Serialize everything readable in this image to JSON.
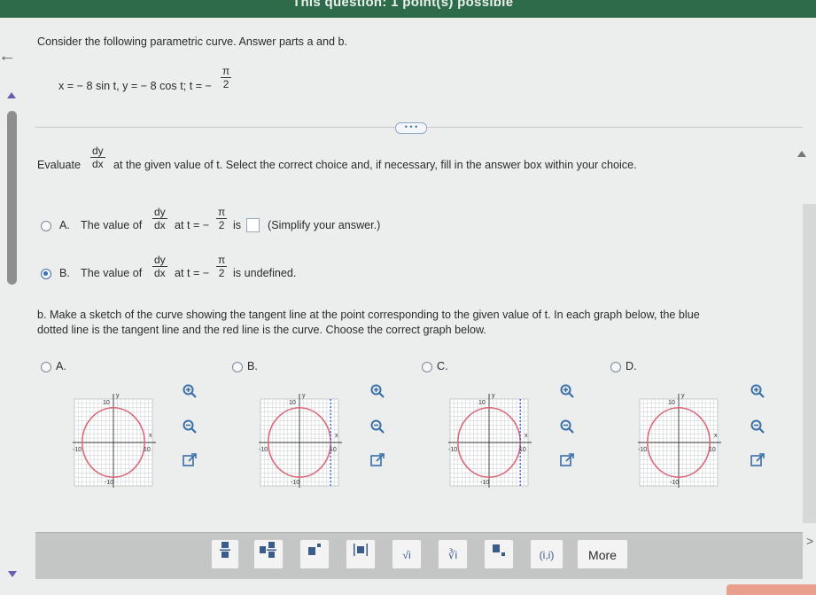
{
  "header": {
    "title": "This question: 1 point(s) possible"
  },
  "question": {
    "intro": "Consider the following parametric curve. Answer parts a and b.",
    "equation_prefix": "x = − 8 sin t, y = − 8 cos t; t = −",
    "t_num": "π",
    "t_den": "2",
    "more_indicator": "• • •"
  },
  "part_a": {
    "evaluate_word": "Evaluate",
    "dy": "dy",
    "dx": "dx",
    "evaluate_rest": "at the given value of t. Select the correct choice and, if necessary, fill in the answer box within your choice.",
    "choices": [
      {
        "letter": "A.",
        "lead": "The value of",
        "at_t": "at t = −",
        "tail": "is",
        "note": "(Simplify your answer.)",
        "selected": false
      },
      {
        "letter": "B.",
        "lead": "The value of",
        "at_t": "at t = −",
        "tail": "is undefined.",
        "selected": true
      }
    ]
  },
  "part_b": {
    "text_line1": "b. Make a sketch of the curve showing the tangent line at the point corresponding to the given value of t. In each graph below, the blue",
    "text_line2": "dotted line is the tangent line and the red line is the curve. Choose the correct graph below.",
    "graphs": [
      {
        "letter": "A.",
        "tangent": "none"
      },
      {
        "letter": "B.",
        "tangent": "vertical-right"
      },
      {
        "letter": "C.",
        "tangent": "vertical-right"
      },
      {
        "letter": "D.",
        "tangent": "none"
      }
    ],
    "axis": {
      "x_label": "x",
      "y_label": "y",
      "neg_ten": "-10",
      "pos_ten": "10"
    }
  },
  "toolbar": {
    "items": [
      "fraction",
      "mixed-number",
      "exponent",
      "absolute-value",
      "square-root",
      "nth-root",
      "subscript",
      "ordered-pair"
    ],
    "sqrt_label": "√i",
    "nthroot_label": "∛i",
    "pair_label": "(i,i)",
    "more_label": "More"
  },
  "colors": {
    "header": "#2e6b4a",
    "accent": "#3b6fb0",
    "curve": "#d96b7b",
    "tangent": "#3a5fc8"
  }
}
